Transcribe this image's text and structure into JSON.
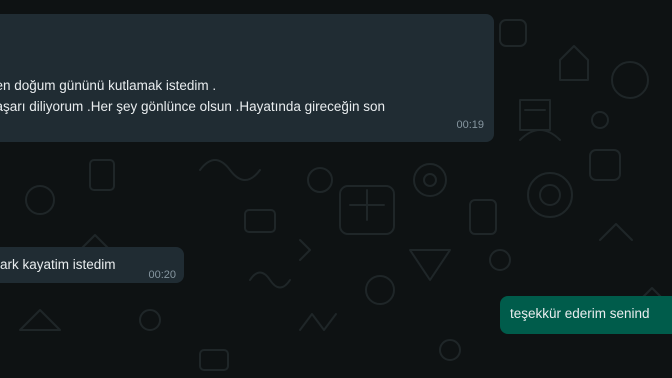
{
  "messages": [
    {
      "direction": "incoming",
      "lines": [
        "den doğum gününü kutlamak istedim .",
        "başarı diliyorum .Her şey gönlünce olsun .Hayatında gireceğin son",
        ")"
      ],
      "time": "00:19"
    },
    {
      "direction": "incoming",
      "lines": [
        "ark kayatim istedim"
      ],
      "time": "00:20"
    },
    {
      "direction": "outgoing",
      "lines": [
        "teşekkür ederim senind"
      ],
      "time": ""
    }
  ],
  "colors": {
    "background": "#0e1213",
    "incoming_bubble": "#202c33",
    "outgoing_bubble": "#005c4b",
    "text": "#e9edef",
    "timestamp": "#8696a0"
  },
  "wallpaper": "doodle-pattern"
}
